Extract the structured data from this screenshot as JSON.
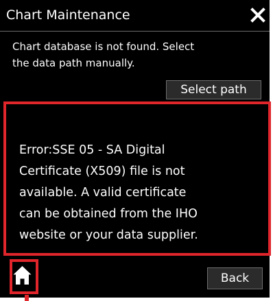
{
  "dialog": {
    "title": "Chart Maintenance",
    "message_line1": "Chart database is not found. Select",
    "message_line2": "the data path manually.",
    "select_path_label": "Select path",
    "error_lines": [
      "Error:SSE 05 - SA Digital",
      "Certificate (X509) file is not",
      "available. A valid certificate",
      "can be obtained from the IHO",
      "website or your data supplier."
    ],
    "back_label": "Back"
  },
  "icons": {
    "close": "close-icon",
    "home": "home-icon"
  },
  "colors": {
    "dialog_background": "#000000",
    "text": "#ffffff",
    "highlight_frame": "#e0252b",
    "button_background": "#2b2b2b"
  }
}
